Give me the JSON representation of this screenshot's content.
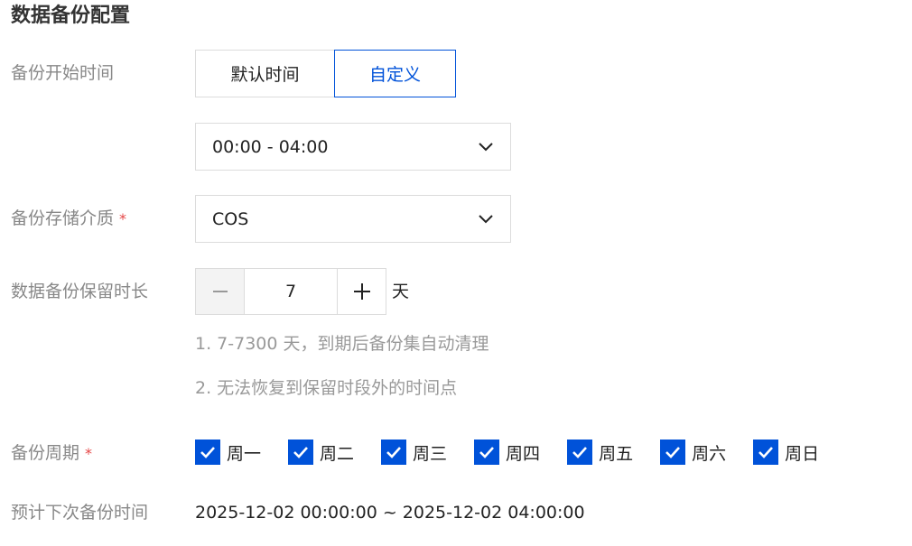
{
  "section_title": "数据备份配置",
  "backup_start": {
    "label": "备份开始时间",
    "options": [
      "默认时间",
      "自定义"
    ],
    "selected": "自定义",
    "time_range": "00:00 - 04:00"
  },
  "storage": {
    "label": "备份存储介质",
    "required_mark": "*",
    "value": "COS"
  },
  "retention": {
    "label": "数据备份保留时长",
    "value": "7",
    "unit": "天",
    "hints": [
      "1. 7-7300 天，到期后备份集自动清理",
      "2. 无法恢复到保留时段外的时间点"
    ]
  },
  "cycle": {
    "label": "备份周期",
    "required_mark": "*",
    "days": [
      {
        "label": "周一",
        "checked": true
      },
      {
        "label": "周二",
        "checked": true
      },
      {
        "label": "周三",
        "checked": true
      },
      {
        "label": "周四",
        "checked": true
      },
      {
        "label": "周五",
        "checked": true
      },
      {
        "label": "周六",
        "checked": true
      },
      {
        "label": "周日",
        "checked": true
      }
    ]
  },
  "next_backup": {
    "label": "预计下次备份时间",
    "value": "2025-12-02 00:00:00 ~ 2025-12-02 04:00:00"
  },
  "colors": {
    "primary": "#0052d9",
    "required": "#e54545",
    "label_gray": "#888888"
  }
}
